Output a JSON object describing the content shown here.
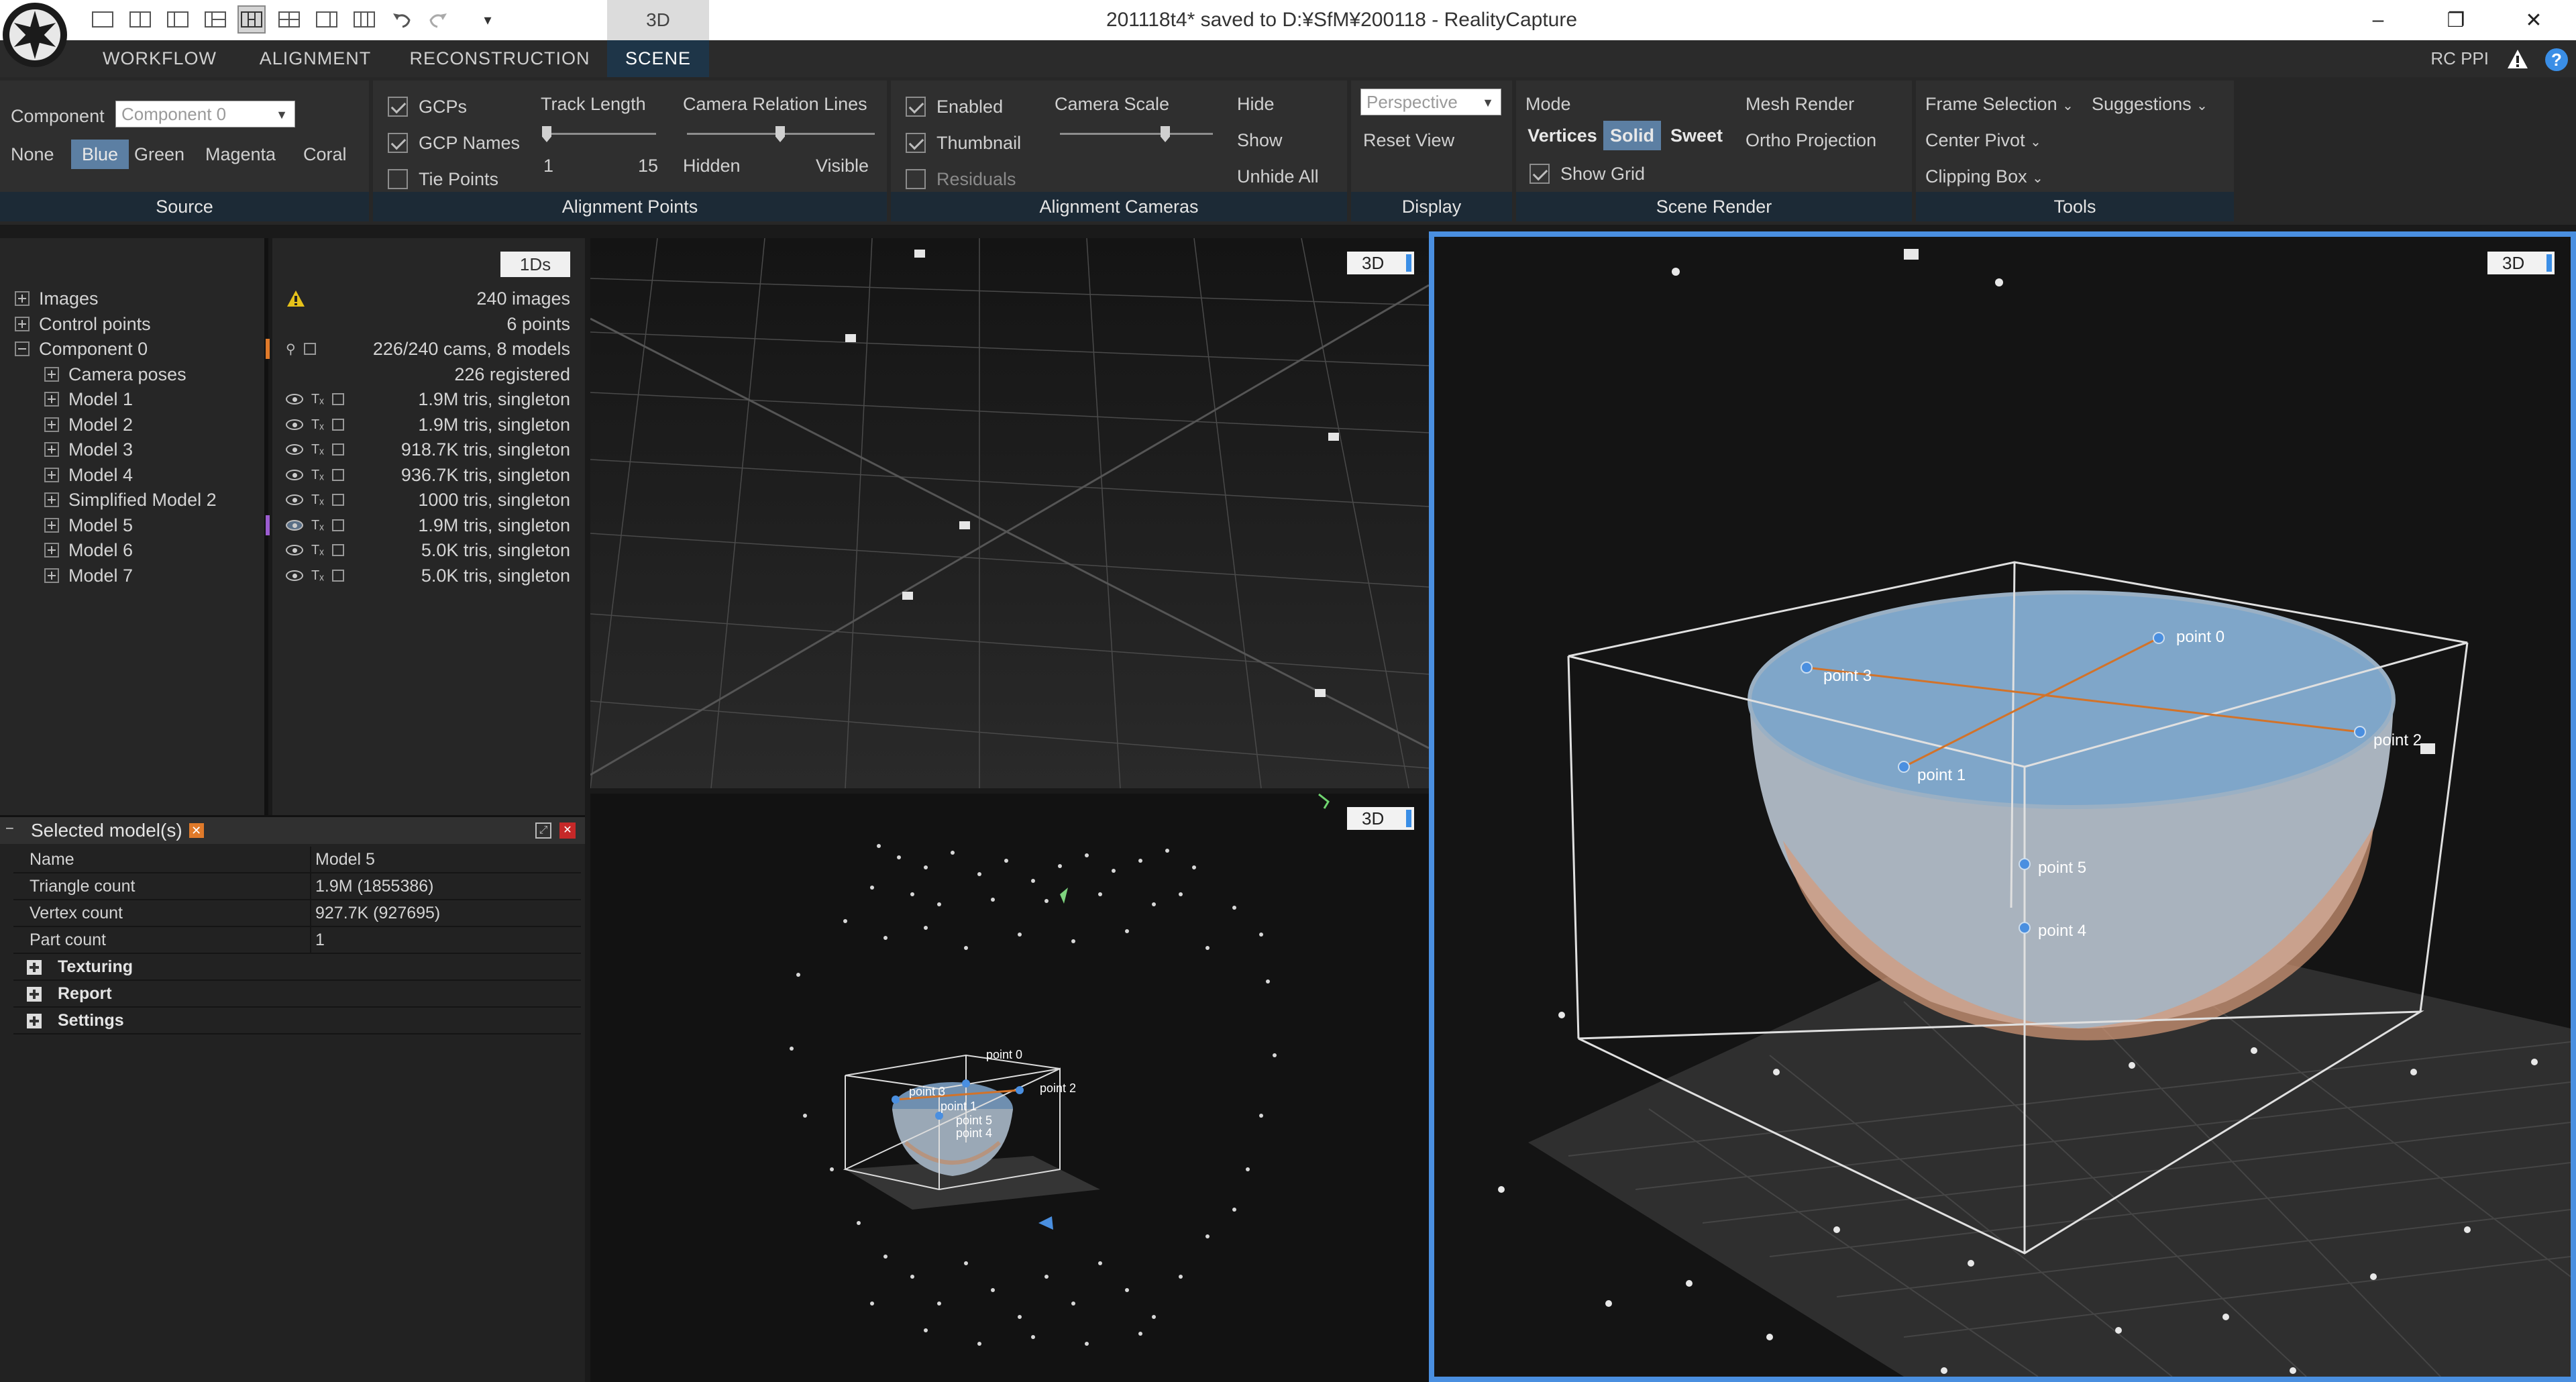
{
  "titlebar": {
    "window_title": "201118t4* saved to D:¥SfM¥200118 - RealityCapture",
    "context_tab": "3D",
    "minimize": "–",
    "restore": "❐",
    "close": "✕"
  },
  "ribbon_tabs": [
    "WORKFLOW",
    "ALIGNMENT",
    "RECONSTRUCTION",
    "SCENE"
  ],
  "ribbon_right": {
    "ppi": "RC PPI",
    "help": "?"
  },
  "ribbon": {
    "source": {
      "title": "Source",
      "component_label": "Component",
      "component_value": "Component 0",
      "colors": [
        "None",
        "Blue",
        "Green",
        "Magenta",
        "Coral"
      ],
      "selected_color": "Blue"
    },
    "alignment_points": {
      "title": "Alignment Points",
      "gcps": "GCPs",
      "gcp_names": "GCP Names",
      "tie_points": "Tie Points",
      "track_length": "Track Length",
      "track_min": "1",
      "track_max": "15",
      "relation_lines": "Camera Relation Lines",
      "hidden": "Hidden",
      "visible": "Visible"
    },
    "alignment_cameras": {
      "title": "Alignment Cameras",
      "enabled": "Enabled",
      "thumbnail": "Thumbnail",
      "residuals": "Residuals",
      "camera_scale": "Camera Scale",
      "hide": "Hide",
      "show": "Show",
      "unhide_all": "Unhide All"
    },
    "display": {
      "title": "Display",
      "projection_placeholder": "Perspective",
      "reset_view": "Reset View"
    },
    "scene_render": {
      "title": "Scene Render",
      "mode": "Mode",
      "vertices": "Vertices",
      "solid": "Solid",
      "sweet": "Sweet",
      "mesh_render": "Mesh Render",
      "ortho_projection": "Ortho Projection",
      "show_grid": "Show Grid"
    },
    "tools": {
      "title": "Tools",
      "frame_selection": "Frame Selection",
      "suggestions": "Suggestions",
      "center_pivot": "Center Pivot",
      "clipping_box": "Clipping Box"
    }
  },
  "tree": {
    "button_1ds": "1Ds",
    "rows": [
      {
        "label": "Images",
        "info": "240 images",
        "indent": 0
      },
      {
        "label": "Control points",
        "info": "6 points",
        "indent": 0
      },
      {
        "label": "Component 0",
        "info": "226/240 cams, 8 models",
        "indent": 0
      },
      {
        "label": "Camera poses",
        "info": "226 registered",
        "indent": 1
      },
      {
        "label": "Model 1",
        "info": "1.9M tris, singleton",
        "indent": 1
      },
      {
        "label": "Model 2",
        "info": "1.9M tris, singleton",
        "indent": 1
      },
      {
        "label": "Model 3",
        "info": "918.7K tris, singleton",
        "indent": 1
      },
      {
        "label": "Model 4",
        "info": "936.7K tris, singleton",
        "indent": 1
      },
      {
        "label": "Simplified Model 2",
        "info": "1000 tris, singleton",
        "indent": 1
      },
      {
        "label": "Model 5",
        "info": "1.9M tris, singleton",
        "indent": 1
      },
      {
        "label": "Model 6",
        "info": "5.0K tris, singleton",
        "indent": 1
      },
      {
        "label": "Model 7",
        "info": "5.0K tris, singleton",
        "indent": 1
      }
    ]
  },
  "selected_panel": {
    "title": "Selected model(s)",
    "properties": [
      {
        "key": "Name",
        "value": "Model 5"
      },
      {
        "key": "Triangle count",
        "value": "1.9M (1855386)"
      },
      {
        "key": "Vertex count",
        "value": "927.7K (927695)"
      },
      {
        "key": "Part count",
        "value": "1"
      }
    ],
    "groups": [
      "Texturing",
      "Report",
      "Settings"
    ]
  },
  "viewports": {
    "button_label": "3D",
    "point_labels": [
      "point 0",
      "point 2",
      "point 3",
      "point 1",
      "point 5",
      "point 4"
    ],
    "bowl_color": "#7fa6c9",
    "selection_color": "#4a8fe0"
  }
}
